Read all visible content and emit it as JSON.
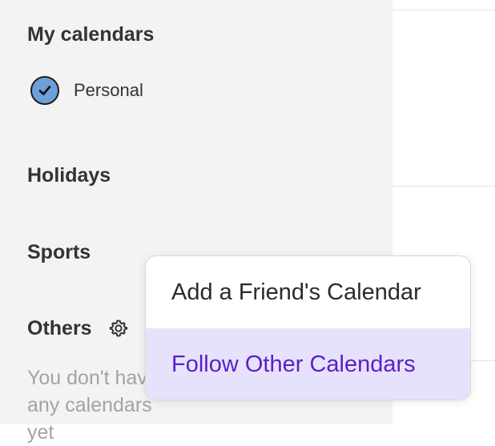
{
  "sidebar": {
    "my_calendars": {
      "title": "My calendars",
      "items": [
        {
          "label": "Personal",
          "checked": true,
          "color": "#6d9fd8"
        }
      ]
    },
    "holidays": {
      "title": "Holidays"
    },
    "sports": {
      "title": "Sports"
    },
    "others": {
      "title": "Others",
      "icon": "gear-icon",
      "empty_message": "You don't have any calendars yet"
    }
  },
  "dropdown_menu": {
    "items": [
      {
        "label": "Add a Friend's Calendar",
        "highlighted": false
      },
      {
        "label": "Follow Other Calendars",
        "highlighted": true,
        "color": "#5b1fc8",
        "background": "#e7e2fb"
      }
    ]
  }
}
